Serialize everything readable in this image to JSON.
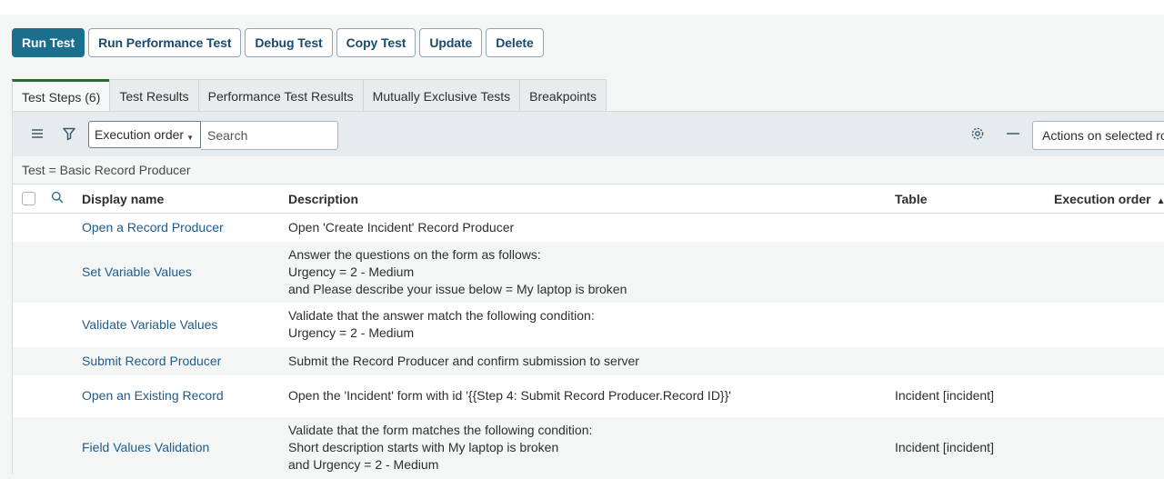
{
  "actions": {
    "run_test": "Run Test",
    "run_performance_test": "Run Performance Test",
    "debug_test": "Debug Test",
    "copy_test": "Copy Test",
    "update": "Update",
    "delete": "Delete"
  },
  "tabs": [
    {
      "label": "Test Steps (6)",
      "active": true
    },
    {
      "label": "Test Results"
    },
    {
      "label": "Performance Test Results"
    },
    {
      "label": "Mutually Exclusive Tests"
    },
    {
      "label": "Breakpoints"
    }
  ],
  "toolbar": {
    "order_select": "Execution order",
    "search_placeholder": "Search",
    "actions_select": "Actions on selected rows..."
  },
  "breadcrumb": "Test = Basic Record Producer",
  "columns": {
    "display_name": "Display name",
    "description": "Description",
    "table": "Table",
    "execution_order": "Execution order"
  },
  "rows": [
    {
      "name": "Open a Record Producer",
      "desc": [
        "Open 'Create Incident' Record Producer"
      ],
      "table": ""
    },
    {
      "name": "Set Variable Values",
      "desc": [
        "Answer the questions on the form as follows:",
        "Urgency = 2 - Medium",
        "and Please describe your issue below = My laptop is broken"
      ],
      "table": ""
    },
    {
      "name": "Validate Variable Values",
      "desc": [
        "Validate that the answer match the following condition:",
        "Urgency = 2 - Medium"
      ],
      "table": ""
    },
    {
      "name": "Submit Record Producer",
      "desc": [
        "Submit the Record Producer and confirm submission to server"
      ],
      "table": ""
    },
    {
      "name": "Open an Existing Record",
      "desc": [
        "Open the 'Incident' form with id '{{Step 4: Submit Record Producer.Record ID}}'"
      ],
      "table": "Incident [incident]"
    },
    {
      "name": "Field Values Validation",
      "desc": [
        "Validate that the form matches the following condition:",
        "Short description starts with My laptop is broken",
        "and Urgency = 2 - Medium"
      ],
      "table": "Incident [incident]"
    }
  ]
}
